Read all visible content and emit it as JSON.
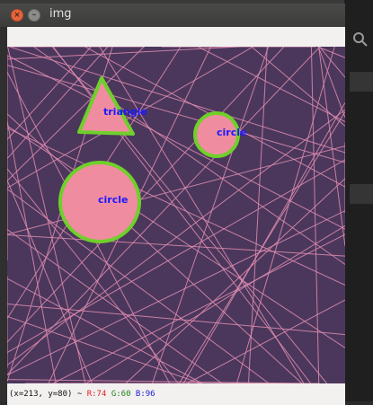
{
  "window": {
    "title": "img"
  },
  "shapes": [
    {
      "label": "triangle"
    },
    {
      "label": "circle"
    },
    {
      "label": "circle"
    }
  ],
  "status": {
    "coords": "(x=213, y=80) ~",
    "r": "R:74",
    "g": "G:60",
    "b": "B:96"
  },
  "colors": {
    "canvas_bg": "#4b375c",
    "shape_fill": "#f08ca0",
    "contour": "#6fd02a",
    "contour_dark": "#1a8a1a",
    "label": "#1a1aff",
    "lines": "#e08cb0"
  }
}
